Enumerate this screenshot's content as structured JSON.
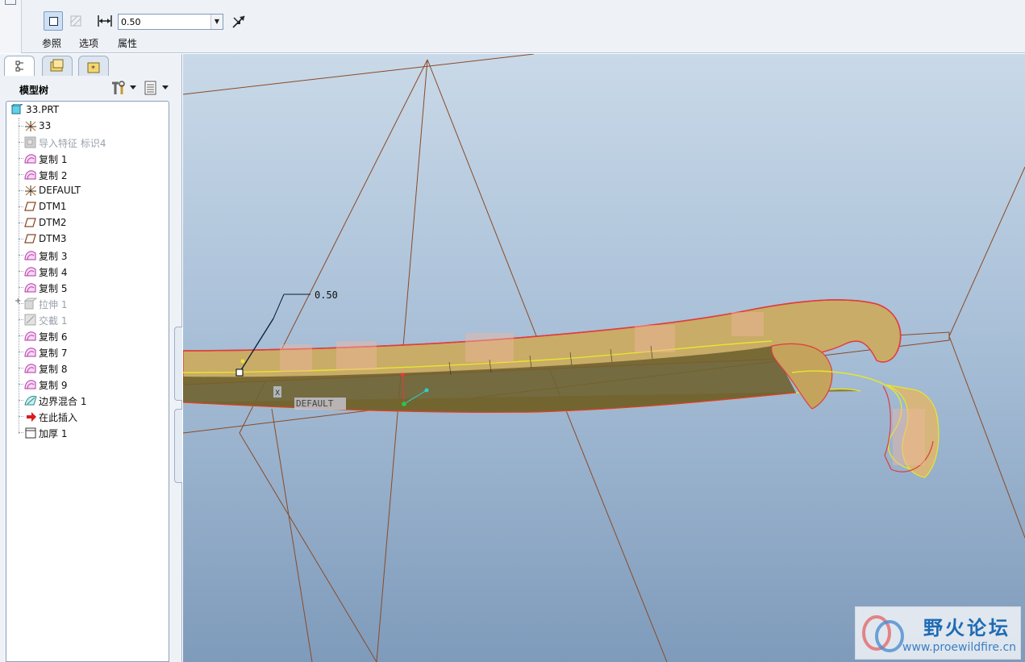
{
  "dashboard": {
    "thickness_value": "0.50",
    "tabs": [
      "参照",
      "选项",
      "属性"
    ]
  },
  "navigator": {
    "title": "模型树",
    "tree": [
      {
        "label": "33.PRT",
        "icon": "part-icon",
        "dim": false
      },
      {
        "label": "33",
        "icon": "csys-icon",
        "dim": false
      },
      {
        "label": "导入特征 标识4",
        "icon": "import-feature-icon",
        "dim": true
      },
      {
        "label": "复制 1",
        "icon": "copy-surface-icon",
        "dim": false
      },
      {
        "label": "复制 2",
        "icon": "copy-surface-icon",
        "dim": false
      },
      {
        "label": "DEFAULT",
        "icon": "csys-icon",
        "dim": false
      },
      {
        "label": "DTM1",
        "icon": "datum-plane-icon",
        "dim": false
      },
      {
        "label": "DTM2",
        "icon": "datum-plane-icon",
        "dim": false
      },
      {
        "label": "DTM3",
        "icon": "datum-plane-icon",
        "dim": false
      },
      {
        "label": "复制 3",
        "icon": "copy-surface-icon",
        "dim": false
      },
      {
        "label": "复制 4",
        "icon": "copy-surface-icon",
        "dim": false
      },
      {
        "label": "复制 5",
        "icon": "copy-surface-icon",
        "dim": false
      },
      {
        "label": "拉伸 1",
        "icon": "extrude-icon",
        "dim": true
      },
      {
        "label": "交截 1",
        "icon": "intersect-icon",
        "dim": true
      },
      {
        "label": "复制 6",
        "icon": "copy-surface-icon",
        "dim": false
      },
      {
        "label": "复制 7",
        "icon": "copy-surface-icon",
        "dim": false
      },
      {
        "label": "复制 8",
        "icon": "copy-surface-icon",
        "dim": false
      },
      {
        "label": "复制 9",
        "icon": "copy-surface-icon",
        "dim": false
      },
      {
        "label": "边界混合 1",
        "icon": "boundary-blend-icon",
        "dim": false
      },
      {
        "label": "在此插入",
        "icon": "insert-here-arrow-icon",
        "dim": false
      },
      {
        "label": "加厚 1",
        "icon": "thicken-icon",
        "dim": false
      }
    ]
  },
  "graphics": {
    "dimension_label": "0.50",
    "csys_label": "DEFAULT",
    "axis_label": "X"
  },
  "watermark": {
    "title": "野火论坛",
    "url": "www.proewildfire.cn"
  }
}
